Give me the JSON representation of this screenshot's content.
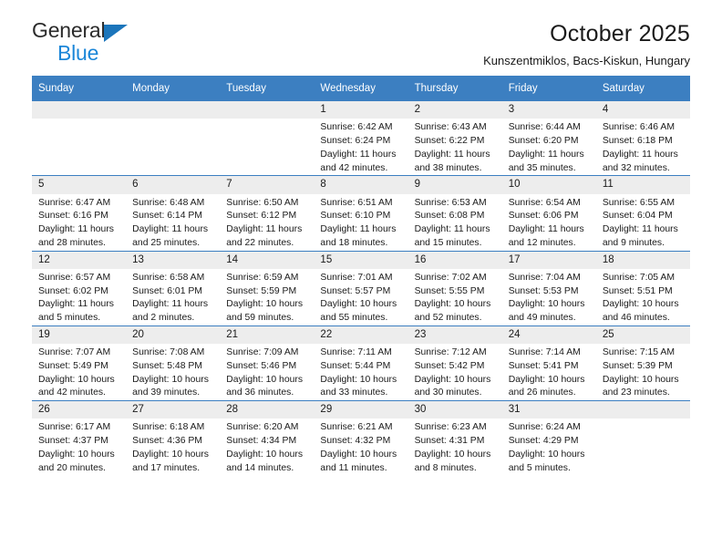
{
  "logo": {
    "primary_text": "General",
    "secondary_text": "Blue",
    "triangle_color": "#1b75bb",
    "secondary_color": "#1b86d8"
  },
  "header": {
    "title": "October 2025",
    "subtitle": "Kunszentmiklos, Bacs-Kiskun, Hungary"
  },
  "colors": {
    "header_row_bg": "#3c7fc1",
    "daynum_bg": "#ededed",
    "grid_line": "#3c7fc1",
    "text": "#1a1a1a"
  },
  "weekday_headers": [
    "Sunday",
    "Monday",
    "Tuesday",
    "Wednesday",
    "Thursday",
    "Friday",
    "Saturday"
  ],
  "labels": {
    "sunrise_prefix": "Sunrise:",
    "sunset_prefix": "Sunset:",
    "daylight_prefix": "Daylight:"
  },
  "weeks": [
    [
      {
        "day": "",
        "empty": true
      },
      {
        "day": "",
        "empty": true
      },
      {
        "day": "",
        "empty": true
      },
      {
        "day": "1",
        "sunrise": "Sunrise: 6:42 AM",
        "sunset": "Sunset: 6:24 PM",
        "daylight": "Daylight: 11 hours and 42 minutes."
      },
      {
        "day": "2",
        "sunrise": "Sunrise: 6:43 AM",
        "sunset": "Sunset: 6:22 PM",
        "daylight": "Daylight: 11 hours and 38 minutes."
      },
      {
        "day": "3",
        "sunrise": "Sunrise: 6:44 AM",
        "sunset": "Sunset: 6:20 PM",
        "daylight": "Daylight: 11 hours and 35 minutes."
      },
      {
        "day": "4",
        "sunrise": "Sunrise: 6:46 AM",
        "sunset": "Sunset: 6:18 PM",
        "daylight": "Daylight: 11 hours and 32 minutes."
      }
    ],
    [
      {
        "day": "5",
        "sunrise": "Sunrise: 6:47 AM",
        "sunset": "Sunset: 6:16 PM",
        "daylight": "Daylight: 11 hours and 28 minutes."
      },
      {
        "day": "6",
        "sunrise": "Sunrise: 6:48 AM",
        "sunset": "Sunset: 6:14 PM",
        "daylight": "Daylight: 11 hours and 25 minutes."
      },
      {
        "day": "7",
        "sunrise": "Sunrise: 6:50 AM",
        "sunset": "Sunset: 6:12 PM",
        "daylight": "Daylight: 11 hours and 22 minutes."
      },
      {
        "day": "8",
        "sunrise": "Sunrise: 6:51 AM",
        "sunset": "Sunset: 6:10 PM",
        "daylight": "Daylight: 11 hours and 18 minutes."
      },
      {
        "day": "9",
        "sunrise": "Sunrise: 6:53 AM",
        "sunset": "Sunset: 6:08 PM",
        "daylight": "Daylight: 11 hours and 15 minutes."
      },
      {
        "day": "10",
        "sunrise": "Sunrise: 6:54 AM",
        "sunset": "Sunset: 6:06 PM",
        "daylight": "Daylight: 11 hours and 12 minutes."
      },
      {
        "day": "11",
        "sunrise": "Sunrise: 6:55 AM",
        "sunset": "Sunset: 6:04 PM",
        "daylight": "Daylight: 11 hours and 9 minutes."
      }
    ],
    [
      {
        "day": "12",
        "sunrise": "Sunrise: 6:57 AM",
        "sunset": "Sunset: 6:02 PM",
        "daylight": "Daylight: 11 hours and 5 minutes."
      },
      {
        "day": "13",
        "sunrise": "Sunrise: 6:58 AM",
        "sunset": "Sunset: 6:01 PM",
        "daylight": "Daylight: 11 hours and 2 minutes."
      },
      {
        "day": "14",
        "sunrise": "Sunrise: 6:59 AM",
        "sunset": "Sunset: 5:59 PM",
        "daylight": "Daylight: 10 hours and 59 minutes."
      },
      {
        "day": "15",
        "sunrise": "Sunrise: 7:01 AM",
        "sunset": "Sunset: 5:57 PM",
        "daylight": "Daylight: 10 hours and 55 minutes."
      },
      {
        "day": "16",
        "sunrise": "Sunrise: 7:02 AM",
        "sunset": "Sunset: 5:55 PM",
        "daylight": "Daylight: 10 hours and 52 minutes."
      },
      {
        "day": "17",
        "sunrise": "Sunrise: 7:04 AM",
        "sunset": "Sunset: 5:53 PM",
        "daylight": "Daylight: 10 hours and 49 minutes."
      },
      {
        "day": "18",
        "sunrise": "Sunrise: 7:05 AM",
        "sunset": "Sunset: 5:51 PM",
        "daylight": "Daylight: 10 hours and 46 minutes."
      }
    ],
    [
      {
        "day": "19",
        "sunrise": "Sunrise: 7:07 AM",
        "sunset": "Sunset: 5:49 PM",
        "daylight": "Daylight: 10 hours and 42 minutes."
      },
      {
        "day": "20",
        "sunrise": "Sunrise: 7:08 AM",
        "sunset": "Sunset: 5:48 PM",
        "daylight": "Daylight: 10 hours and 39 minutes."
      },
      {
        "day": "21",
        "sunrise": "Sunrise: 7:09 AM",
        "sunset": "Sunset: 5:46 PM",
        "daylight": "Daylight: 10 hours and 36 minutes."
      },
      {
        "day": "22",
        "sunrise": "Sunrise: 7:11 AM",
        "sunset": "Sunset: 5:44 PM",
        "daylight": "Daylight: 10 hours and 33 minutes."
      },
      {
        "day": "23",
        "sunrise": "Sunrise: 7:12 AM",
        "sunset": "Sunset: 5:42 PM",
        "daylight": "Daylight: 10 hours and 30 minutes."
      },
      {
        "day": "24",
        "sunrise": "Sunrise: 7:14 AM",
        "sunset": "Sunset: 5:41 PM",
        "daylight": "Daylight: 10 hours and 26 minutes."
      },
      {
        "day": "25",
        "sunrise": "Sunrise: 7:15 AM",
        "sunset": "Sunset: 5:39 PM",
        "daylight": "Daylight: 10 hours and 23 minutes."
      }
    ],
    [
      {
        "day": "26",
        "sunrise": "Sunrise: 6:17 AM",
        "sunset": "Sunset: 4:37 PM",
        "daylight": "Daylight: 10 hours and 20 minutes."
      },
      {
        "day": "27",
        "sunrise": "Sunrise: 6:18 AM",
        "sunset": "Sunset: 4:36 PM",
        "daylight": "Daylight: 10 hours and 17 minutes."
      },
      {
        "day": "28",
        "sunrise": "Sunrise: 6:20 AM",
        "sunset": "Sunset: 4:34 PM",
        "daylight": "Daylight: 10 hours and 14 minutes."
      },
      {
        "day": "29",
        "sunrise": "Sunrise: 6:21 AM",
        "sunset": "Sunset: 4:32 PM",
        "daylight": "Daylight: 10 hours and 11 minutes."
      },
      {
        "day": "30",
        "sunrise": "Sunrise: 6:23 AM",
        "sunset": "Sunset: 4:31 PM",
        "daylight": "Daylight: 10 hours and 8 minutes."
      },
      {
        "day": "31",
        "sunrise": "Sunrise: 6:24 AM",
        "sunset": "Sunset: 4:29 PM",
        "daylight": "Daylight: 10 hours and 5 minutes."
      },
      {
        "day": "",
        "empty": true
      }
    ]
  ]
}
